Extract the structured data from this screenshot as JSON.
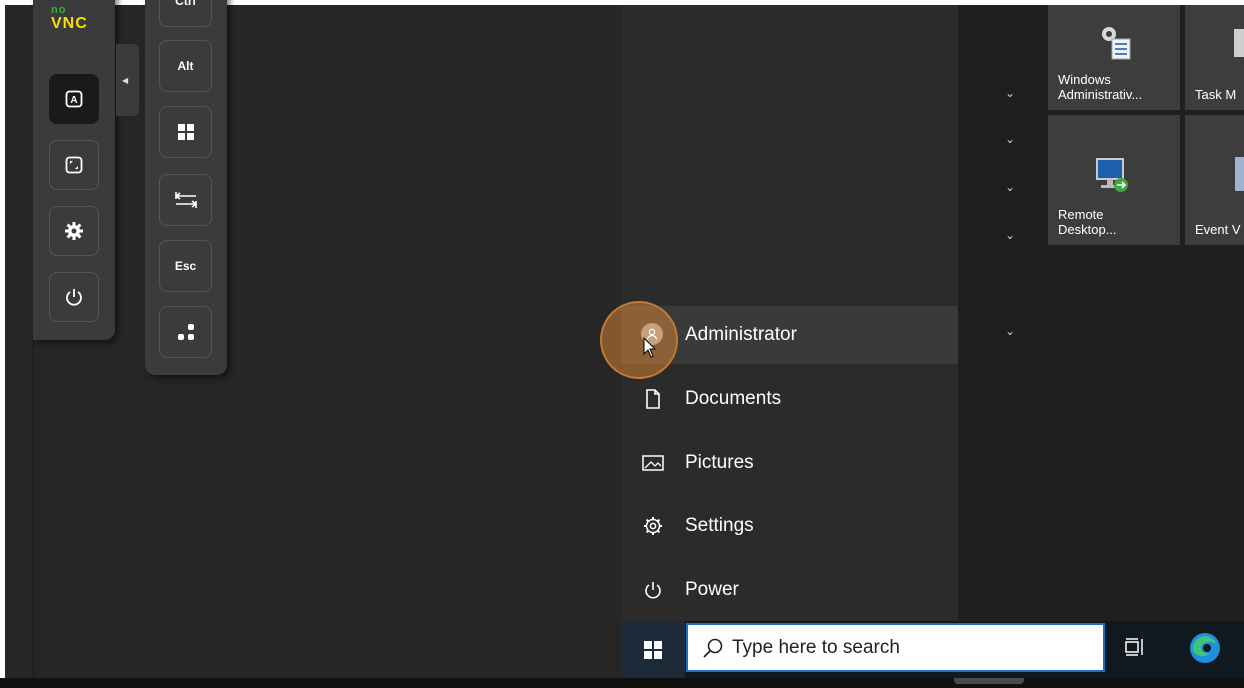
{
  "novnc": {
    "logo_no": "no",
    "logo_vnc": "VNC",
    "buttons": [
      {
        "name": "keyboard-icon",
        "label": "A"
      },
      {
        "name": "fullscreen-icon"
      },
      {
        "name": "gear-icon"
      },
      {
        "name": "power-icon"
      }
    ],
    "handle_arrow": "◀"
  },
  "extra_keys": {
    "ctrl": "Ctrl",
    "alt": "Alt",
    "esc": "Esc"
  },
  "start_menu": {
    "items": [
      {
        "label": "Administrator",
        "icon": "user-avatar-icon"
      },
      {
        "label": "Documents",
        "icon": "document-icon"
      },
      {
        "label": "Pictures",
        "icon": "pictures-icon"
      },
      {
        "label": "Settings",
        "icon": "gear-icon"
      },
      {
        "label": "Power",
        "icon": "power-icon"
      }
    ],
    "chevron": "⌄",
    "tiles": [
      {
        "label_line1": "Windows",
        "label_line2": "Administrativ...",
        "icon": "admin-tools-icon"
      },
      {
        "label_line1": "",
        "label_line2": "Task M",
        "icon": "task-manager-icon"
      },
      {
        "label_line1": "Remote",
        "label_line2": "Desktop...",
        "icon": "remote-desktop-icon"
      },
      {
        "label_line1": "",
        "label_line2": "Event V",
        "icon": "event-viewer-icon"
      }
    ]
  },
  "taskbar": {
    "search_placeholder": "Type here to search"
  },
  "colors": {
    "accent": "#1b6ec2",
    "highlight": "#c07a34",
    "novnc_green": "#38b137",
    "novnc_yellow": "#f5e100"
  }
}
